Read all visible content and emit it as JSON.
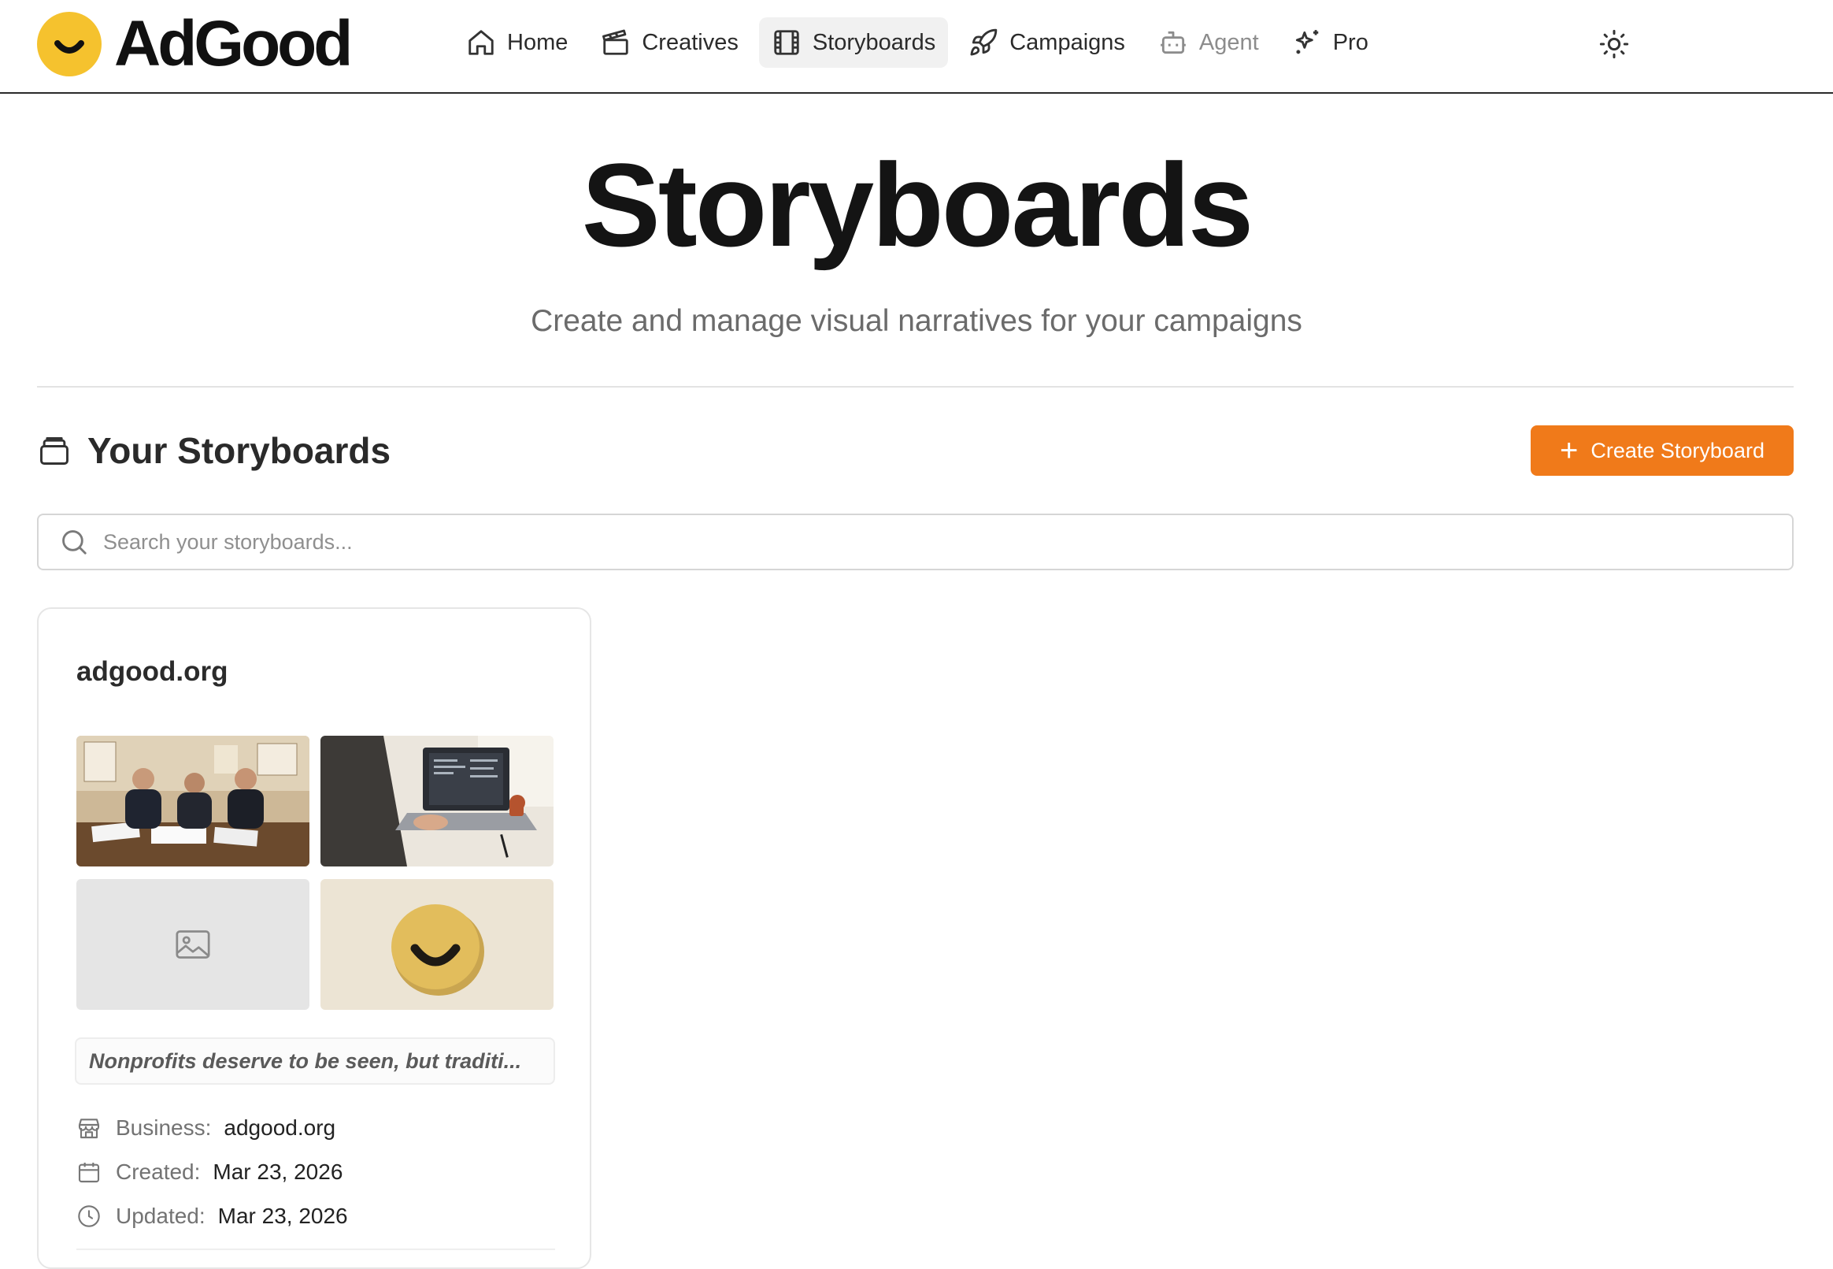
{
  "brand": {
    "name": "AdGood",
    "logo_color": "#f5c22e"
  },
  "nav": {
    "items": [
      {
        "label": "Home",
        "icon": "home-icon",
        "active": false
      },
      {
        "label": "Creatives",
        "icon": "clapperboard-icon",
        "active": false
      },
      {
        "label": "Storyboards",
        "icon": "film-icon",
        "active": true
      },
      {
        "label": "Campaigns",
        "icon": "rocket-icon",
        "active": false
      },
      {
        "label": "Agent",
        "icon": "bot-icon",
        "active": false,
        "disabled": true
      },
      {
        "label": "Pro",
        "icon": "sparkles-icon",
        "active": false
      }
    ],
    "theme_toggle_icon": "sun-icon"
  },
  "hero": {
    "title": "Storyboards",
    "subtitle": "Create and manage visual narratives for your campaigns"
  },
  "section": {
    "title": "Your Storyboards",
    "icon": "stack-icon",
    "create_label": "Create Storyboard",
    "accent": "#f07a1a"
  },
  "search": {
    "placeholder": "Search your storyboards..."
  },
  "storyboards": [
    {
      "title": "adgood.org",
      "thumbnails": [
        "team-meeting-photo",
        "laptop-photo",
        "image-placeholder-icon",
        "smiley-button-photo"
      ],
      "excerpt": "Nonprofits deserve to be seen, but traditi...",
      "business_label": "Business:",
      "business": "adgood.org",
      "created_label": "Created:",
      "created": "Mar 23, 2026",
      "updated_label": "Updated:",
      "updated": "Mar 23, 2026"
    }
  ]
}
